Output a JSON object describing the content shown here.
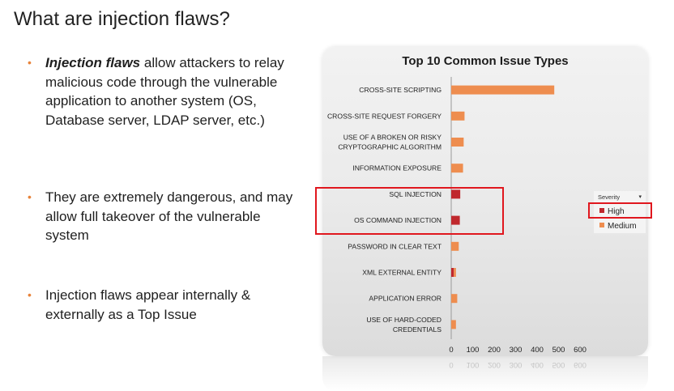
{
  "slide": {
    "title": "What are injection flaws?",
    "bullets": [
      {
        "emphasis": "Injection flaws",
        "text": " allow attackers to relay malicious code through the vulnerable application to another system (OS, Database server, LDAP server, etc.)"
      },
      {
        "emphasis": "",
        "text": "They are extremely dangerous, and may allow full takeover of the vulnerable system"
      },
      {
        "emphasis": "",
        "text": "Injection flaws appear internally & externally as a Top Issue"
      }
    ],
    "bullet_marker": "•"
  },
  "colors": {
    "high": "#c0282d",
    "medium": "#ee8d4f",
    "highlight": "#e0171e",
    "bullet": "#e8833a"
  },
  "chart_data": {
    "type": "bar",
    "orientation": "horizontal",
    "title": "Top 10 Common Issue Types",
    "categories": [
      [
        "CROSS-SITE SCRIPTING"
      ],
      [
        "CROSS-SITE REQUEST FORGERY"
      ],
      [
        "USE OF A BROKEN OR RISKY",
        "CRYPTOGRAPHIC ALGORITHM"
      ],
      [
        "INFORMATION EXPOSURE"
      ],
      [
        "SQL INJECTION"
      ],
      [
        "OS COMMAND INJECTION"
      ],
      [
        "PASSWORD IN CLEAR TEXT"
      ],
      [
        "XML EXTERNAL ENTITY"
      ],
      [
        "APPLICATION ERROR"
      ],
      [
        "USE OF HARD-CODED",
        "CREDENTIALS"
      ]
    ],
    "series": [
      {
        "name": "High",
        "color": "#c0282d",
        "values": [
          0,
          0,
          0,
          0,
          42,
          40,
          0,
          12,
          0,
          0
        ]
      },
      {
        "name": "Medium",
        "color": "#ee8d4f",
        "values": [
          480,
          62,
          58,
          55,
          0,
          0,
          35,
          10,
          28,
          22
        ]
      }
    ],
    "xlim": [
      0,
      600
    ],
    "xticks": [
      "0",
      "100",
      "200",
      "300",
      "400",
      "500",
      "600"
    ],
    "grid": false,
    "legend": {
      "title": "Severity",
      "position": "right"
    }
  },
  "legend": {
    "title": "Severity",
    "caret": "▾",
    "items": [
      "High",
      "Medium"
    ]
  }
}
